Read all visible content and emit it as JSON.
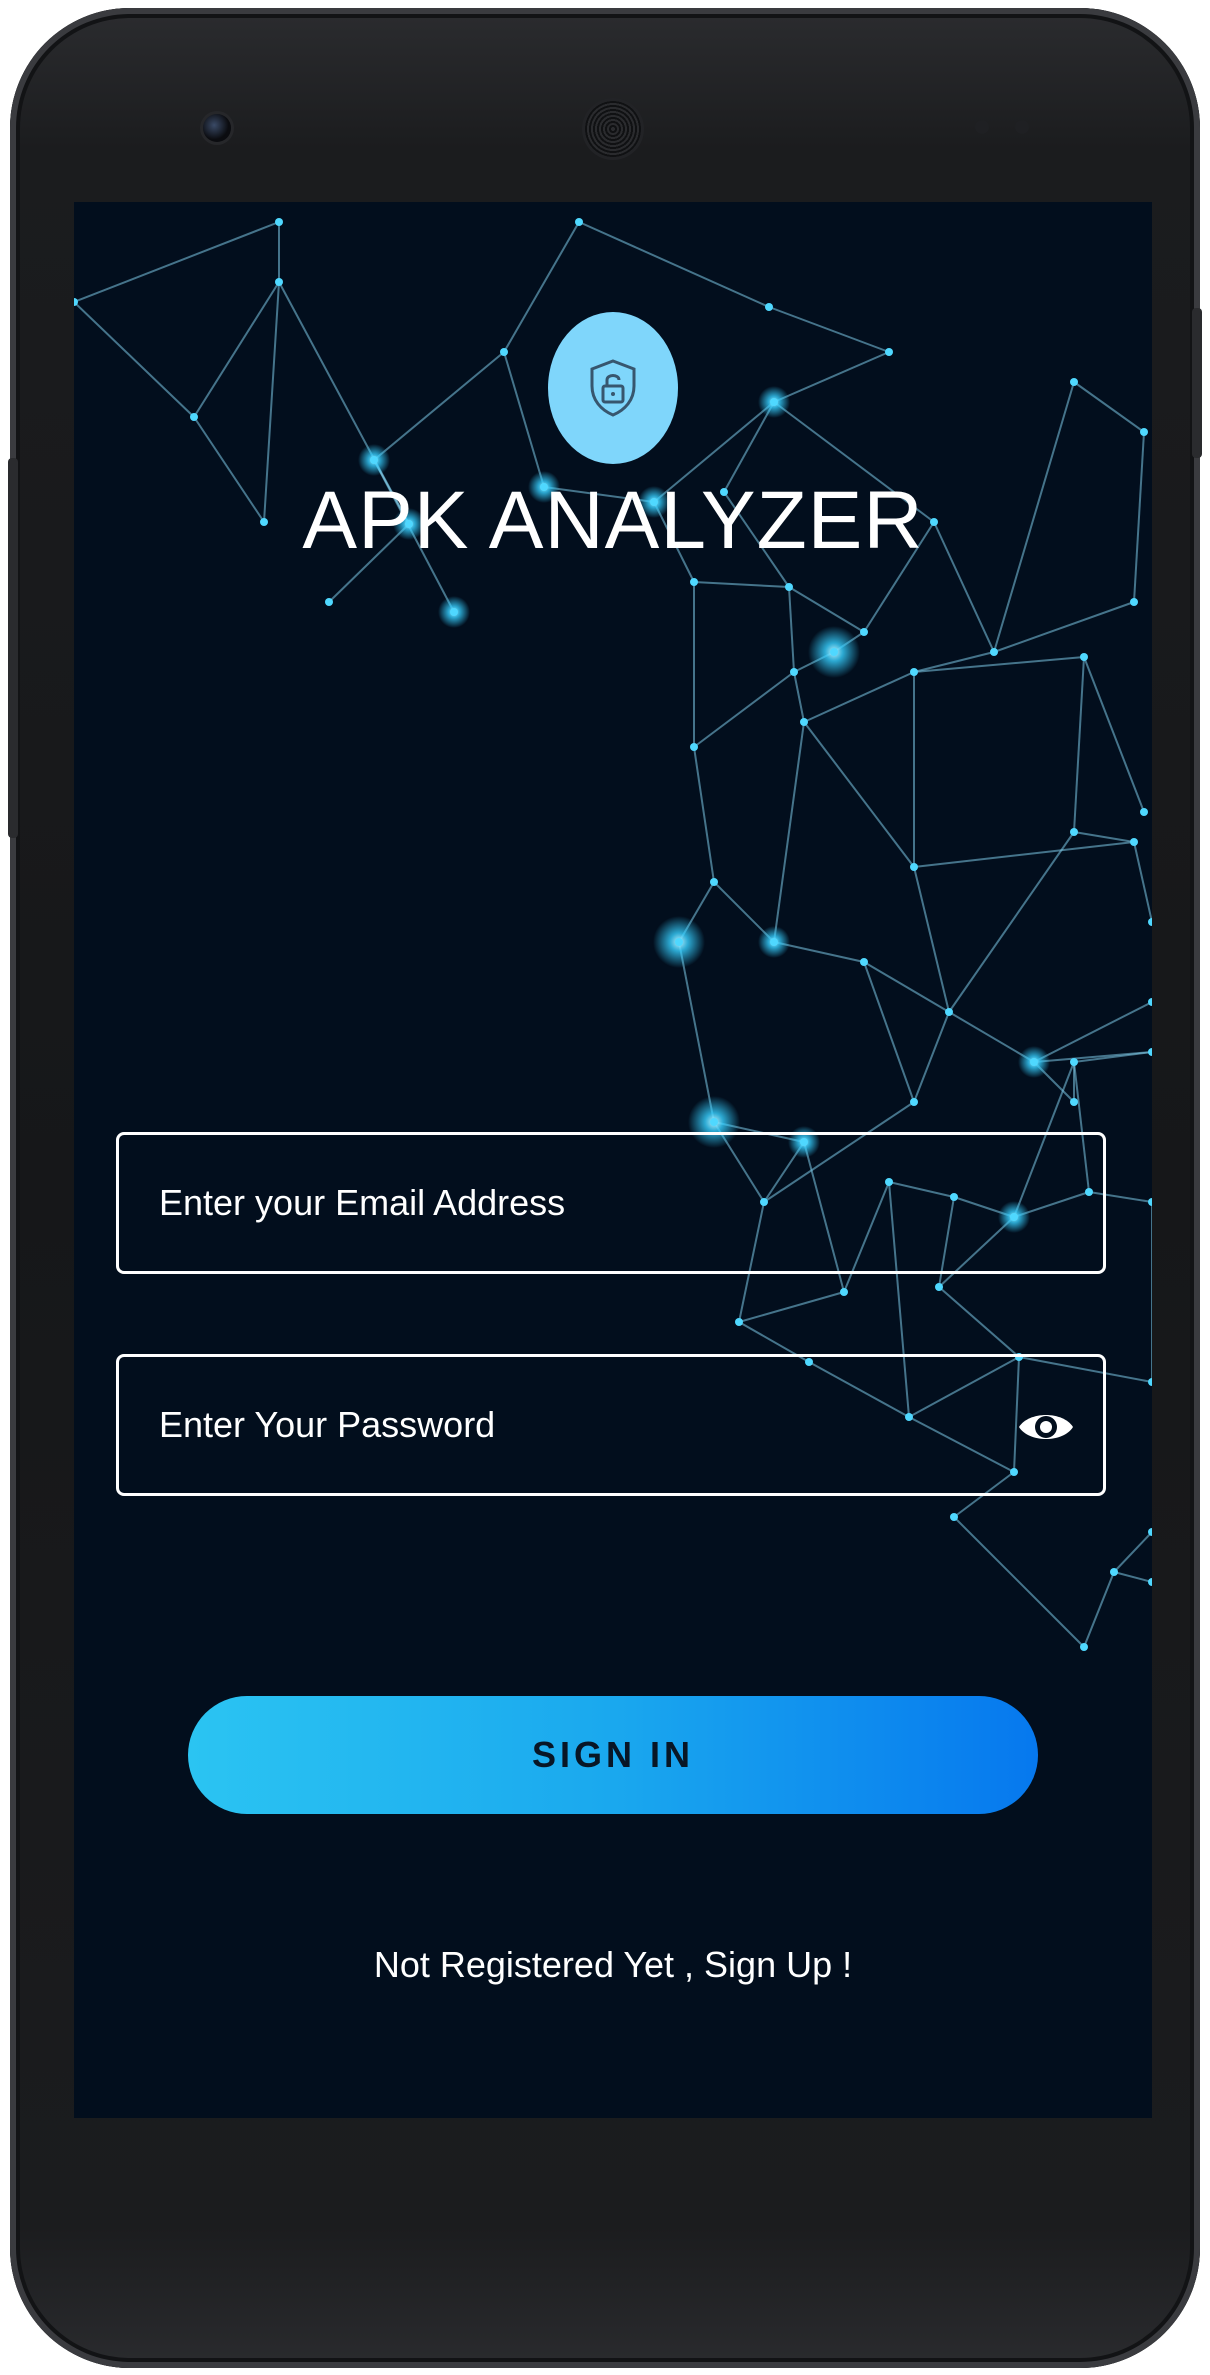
{
  "app": {
    "title": "APK ANALYZER",
    "logo_icon": "shield-lock-icon"
  },
  "login_form": {
    "email_placeholder": "Enter your Email Address",
    "email_value": "",
    "password_placeholder": "Enter Your Password",
    "password_value": "",
    "password_toggle_icon": "eye-icon",
    "sign_in_label": "SIGN IN",
    "sign_up_link": "Not Registered Yet , Sign Up !"
  },
  "colors": {
    "screen_background": "#020e1d",
    "logo_circle": "#7fd6fb",
    "button_gradient_start": "#2bc4f2",
    "button_gradient_end": "#0678ee",
    "network_lines": "#7ec8e6",
    "network_nodes": "#4fd8ff"
  }
}
